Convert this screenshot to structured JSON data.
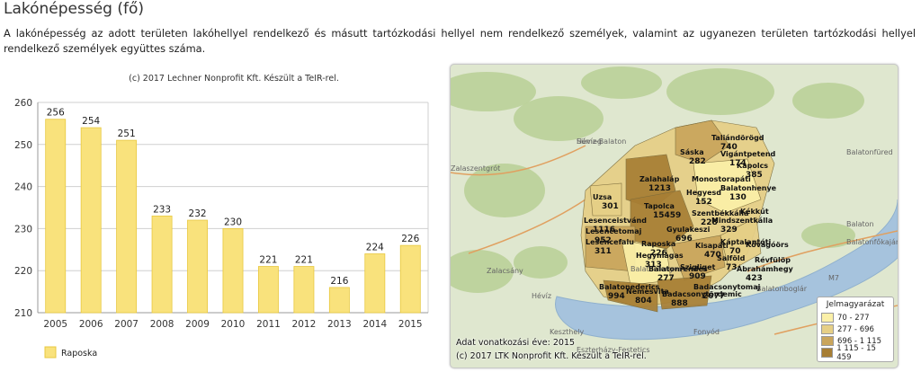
{
  "page": {
    "title": "Lakónépesség (fő)",
    "description": "A lakónépesség az adott területen lakóhellyel rendelkező és másutt tartózkodási hellyel nem rendelkező személyek, valamint az ugyanezen területen tartózkodási hellyel rendelkező személyek együttes száma."
  },
  "chart_data": {
    "type": "bar",
    "credit": "(c) 2017 Lechner Nonprofit Kft. Készült a TeIR-rel.",
    "categories": [
      "2005",
      "2006",
      "2007",
      "2008",
      "2009",
      "2010",
      "2011",
      "2012",
      "2013",
      "2014",
      "2015"
    ],
    "series": [
      {
        "name": "Raposka",
        "values": [
          256,
          254,
          251,
          233,
          232,
          230,
          221,
          221,
          216,
          224,
          226
        ]
      }
    ],
    "ylim": [
      210,
      260
    ],
    "yticks": [
      210,
      220,
      230,
      240,
      250,
      260
    ],
    "grid": true,
    "legend_position": "bottom-left",
    "colors": {
      "bar": "#f9e27c",
      "bar_stroke": "#e8c840",
      "grid": "#cfcfcf"
    }
  },
  "map": {
    "credit": "(c) 2017 LTK Nonprofit Kft. Készült a TeIR-rel.",
    "data_year": "Adat vonatkozási éve: 2015",
    "background_places": [
      "Sümeg",
      "Zalaszentgrót",
      "Balatonfüred",
      "Balaton",
      "Balatonfőkajár",
      "Hévíz",
      "Keszthely",
      "Zalacsány",
      "Balatonboglár",
      "Fonyód",
      "M7",
      "Balatonfenyves",
      "Eszterházy-Festetics",
      "Hévíz-Balaton"
    ],
    "settlements": [
      {
        "name": "Taliándörögd",
        "value": "740"
      },
      {
        "name": "Sáska",
        "value": "282"
      },
      {
        "name": "Vigántpetend",
        "value": "174"
      },
      {
        "name": "Kapolcs",
        "value": "385"
      },
      {
        "name": "Zalahaláp",
        "value": "1213"
      },
      {
        "name": "Monostorapáti",
        "value": ""
      },
      {
        "name": "Hegyesd",
        "value": "152"
      },
      {
        "name": "Balatonhenye",
        "value": "130"
      },
      {
        "name": "Uzsa",
        "value": "301"
      },
      {
        "name": "Tapolca",
        "value": "15459"
      },
      {
        "name": "Szentbékkálla",
        "value": "228"
      },
      {
        "name": "Kékkút",
        "value": ""
      },
      {
        "name": "Mindszentkálla",
        "value": "329"
      },
      {
        "name": "Lesenceistvánd",
        "value": "1116"
      },
      {
        "name": "Lesencetomaj",
        "value": "952"
      },
      {
        "name": "Gyulakeszi",
        "value": "696"
      },
      {
        "name": "Lesencefalu",
        "value": "311"
      },
      {
        "name": "Raposka",
        "value": "226"
      },
      {
        "name": "Kisapáti",
        "value": "470"
      },
      {
        "name": "Hegymagas",
        "value": "313"
      },
      {
        "name": "Szigliget",
        "value": "909"
      },
      {
        "name": "Salföld",
        "value": "73"
      },
      {
        "name": "Káptalantóti",
        "value": "70"
      },
      {
        "name": "Kővágóörs",
        "value": ""
      },
      {
        "name": "Ábrahámhegy",
        "value": "423"
      },
      {
        "name": "Révfülöp",
        "value": ""
      },
      {
        "name": "Badacsonytomaj",
        "value": "2077"
      },
      {
        "name": "Balatonederics",
        "value": "994"
      },
      {
        "name": "Nemesvita",
        "value": "804"
      },
      {
        "name": "Badacsonytördemic",
        "value": "888"
      },
      {
        "name": "Balatonrendes",
        "value": "277"
      }
    ],
    "legend": {
      "title": "Jelmagyarázat",
      "items": [
        {
          "label": "70 -  277",
          "color": "#fbf0a8"
        },
        {
          "label": "277 -  696",
          "color": "#e6cf86"
        },
        {
          "label": "696 - 1 115",
          "color": "#c9a55c"
        },
        {
          "label": "1 115 - 15 459",
          "color": "#a77e34"
        }
      ]
    }
  }
}
